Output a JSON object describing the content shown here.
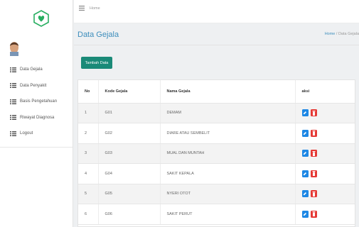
{
  "sidebar": {
    "items": [
      {
        "label": "Data Gejala",
        "icon": "list-icon"
      },
      {
        "label": "Data Penyakit",
        "icon": "list-icon"
      },
      {
        "label": "Basis Pengetahuan",
        "icon": "list-icon"
      },
      {
        "label": "Riwayat Diagnosa",
        "icon": "list-icon"
      },
      {
        "label": "Logout",
        "icon": "list-icon"
      }
    ]
  },
  "topbar": {
    "home": "Home"
  },
  "page": {
    "title": "Data Gejala",
    "breadcrumb_home": "Home",
    "breadcrumb_sep": "/",
    "breadcrumb_current": "Data Gejala"
  },
  "add_button": "Tambah Data",
  "table": {
    "headers": [
      "No",
      "Kode Gejala",
      "Nama Gejala",
      "aksi"
    ],
    "rows": [
      [
        "1",
        "G01",
        "DEMAM"
      ],
      [
        "2",
        "G02",
        "DIARE ATAU SEMBELIT"
      ],
      [
        "3",
        "G03",
        "MUAL DAN MUNTAH"
      ],
      [
        "4",
        "G04",
        "SAKIT KEPALA"
      ],
      [
        "5",
        "G05",
        "NYERI OTOT"
      ],
      [
        "6",
        "G06",
        "SAKIT PERUT"
      ]
    ]
  },
  "colors": {
    "accent": "#3c8dbc",
    "add": "#1a8a78",
    "edit": "#1e88e5",
    "delete": "#e53935",
    "logo": "#27ae60"
  }
}
